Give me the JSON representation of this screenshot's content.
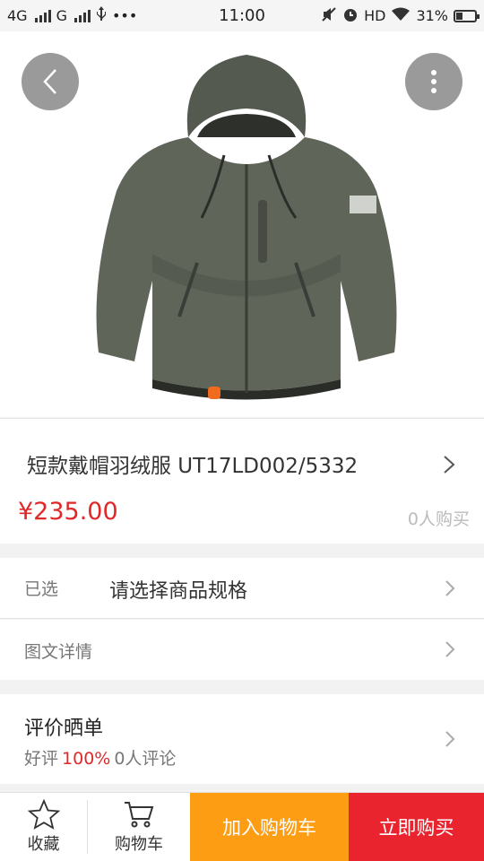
{
  "status_bar": {
    "network1": "4G",
    "network2": "G",
    "extra": "•••",
    "time": "11:00",
    "hd": "HD",
    "battery": "31%"
  },
  "product": {
    "title": "短款戴帽羽绒服 UT17LD002/5332",
    "price": "¥235.00",
    "sold": "0人购买",
    "image_count": 1,
    "current_image": 1
  },
  "spec_row": {
    "label": "已选",
    "value": "请选择商品规格"
  },
  "detail_row": {
    "label": "图文详情"
  },
  "review": {
    "title": "评价晒单",
    "good_label": "好评",
    "good_rate": "100%",
    "count_text": "0人评论"
  },
  "bottom_bar": {
    "favorite": "收藏",
    "cart": "购物车",
    "add_to_cart": "加入购物车",
    "buy_now": "立即购买"
  },
  "colors": {
    "price_red": "#e02828",
    "indicator_orange": "#f06b1e",
    "add_cart_orange": "#fd9d13",
    "buy_red": "#e9242f"
  }
}
